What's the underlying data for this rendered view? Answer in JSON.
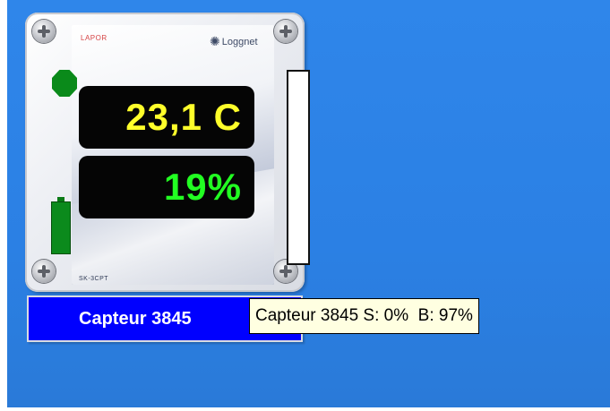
{
  "device": {
    "brand_small": "LAPOR",
    "logo_text": "Loggnet",
    "footer_tag": "SK-3CPT",
    "temperature": "23,1 C",
    "humidity": "19%",
    "status_led_color": "#0a8a1a",
    "battery_level": 0.97,
    "signal_level": 0.0
  },
  "sensor_label": "Capteur 3845",
  "tooltip": "Capteur 3845 S: 0%  B: 97%"
}
